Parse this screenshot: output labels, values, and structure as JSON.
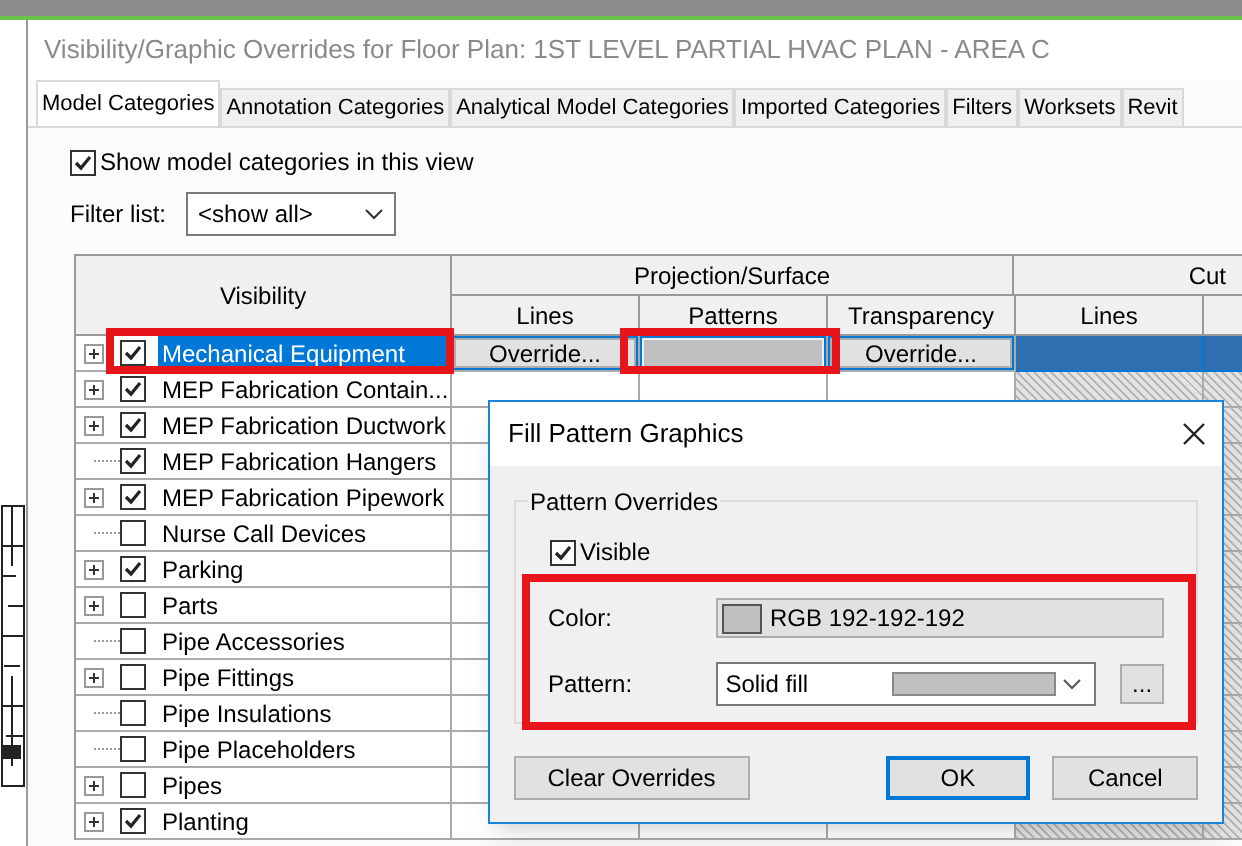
{
  "window": {
    "title": "Visibility/Graphic Overrides for Floor Plan: 1ST LEVEL PARTIAL HVAC PLAN - AREA C"
  },
  "tabs": [
    {
      "label": "Model Categories",
      "selected": true
    },
    {
      "label": "Annotation Categories",
      "selected": false
    },
    {
      "label": "Analytical Model Categories",
      "selected": false
    },
    {
      "label": "Imported Categories",
      "selected": false
    },
    {
      "label": "Filters",
      "selected": false
    },
    {
      "label": "Worksets",
      "selected": false
    },
    {
      "label": "Revit",
      "selected": false
    }
  ],
  "show_model_categories": {
    "label": "Show model categories in this view",
    "checked": true
  },
  "filter_list": {
    "label": "Filter list:",
    "value": "<show all>"
  },
  "table": {
    "visibility_header": "Visibility",
    "groups": [
      "Projection/Surface",
      "Cut"
    ],
    "columns": [
      "Lines",
      "Patterns",
      "Transparency",
      "Lines"
    ],
    "rows": [
      {
        "name": "Mechanical Equipment",
        "expandable": true,
        "checked": true,
        "selected": true,
        "lines": "Override...",
        "transparency": "Override..."
      },
      {
        "name": "MEP Fabrication Contain...",
        "expandable": true,
        "checked": true,
        "selected": false
      },
      {
        "name": "MEP Fabrication Ductwork",
        "expandable": true,
        "checked": true,
        "selected": false
      },
      {
        "name": "MEP Fabrication Hangers",
        "expandable": false,
        "checked": true,
        "selected": false
      },
      {
        "name": "MEP Fabrication Pipework",
        "expandable": true,
        "checked": true,
        "selected": false
      },
      {
        "name": "Nurse Call Devices",
        "expandable": false,
        "checked": false,
        "selected": false
      },
      {
        "name": "Parking",
        "expandable": true,
        "checked": true,
        "selected": false
      },
      {
        "name": "Parts",
        "expandable": true,
        "checked": false,
        "selected": false
      },
      {
        "name": "Pipe Accessories",
        "expandable": false,
        "checked": false,
        "selected": false
      },
      {
        "name": "Pipe Fittings",
        "expandable": true,
        "checked": false,
        "selected": false
      },
      {
        "name": "Pipe Insulations",
        "expandable": false,
        "checked": false,
        "selected": false
      },
      {
        "name": "Pipe Placeholders",
        "expandable": false,
        "checked": false,
        "selected": false
      },
      {
        "name": "Pipes",
        "expandable": true,
        "checked": false,
        "selected": false
      },
      {
        "name": "Planting",
        "expandable": true,
        "checked": true,
        "selected": false
      }
    ]
  },
  "dialog": {
    "title": "Fill Pattern Graphics",
    "group": "Pattern Overrides",
    "visible": {
      "label": "Visible",
      "checked": true
    },
    "color": {
      "label": "Color:",
      "value": "RGB 192-192-192"
    },
    "pattern": {
      "label": "Pattern:",
      "value": "Solid fill",
      "browse": "..."
    },
    "buttons": [
      {
        "label": "Clear Overrides",
        "default": false
      },
      {
        "label": "OK",
        "default": true
      },
      {
        "label": "Cancel",
        "default": false
      }
    ]
  }
}
